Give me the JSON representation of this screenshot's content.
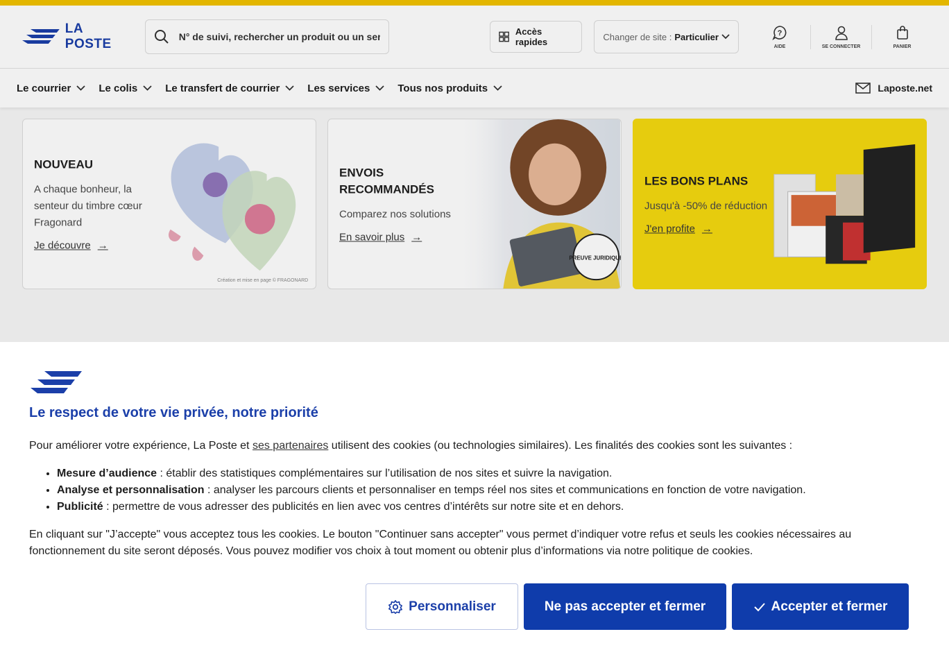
{
  "header": {
    "logo_text": "LA POSTE",
    "search_placeholder": "N° de suivi, rechercher un produit ou un servi...",
    "quick_access": "Accès rapides",
    "site_label": "Changer de site :",
    "site_value": "Particulier",
    "icons": {
      "help": "AIDE",
      "login": "SE CONNECTER",
      "cart": "PANIER"
    }
  },
  "nav": {
    "items": [
      "Le courrier",
      "Le colis",
      "Le transfert de courrier",
      "Les services",
      "Tous nos produits"
    ],
    "mail_link": "Laposte.net"
  },
  "cards": [
    {
      "title": "NOUVEAU",
      "desc": "A chaque bonheur, la senteur du timbre cœur Fragonard",
      "cta": "Je découvre",
      "caption": "Création et mise en page © FRAGONARD"
    },
    {
      "title": "ENVOIS RECOMMANDÉS",
      "desc": "Comparez nos solutions",
      "cta": "En savoir plus",
      "badge": "PREUVE JURIDIQUE"
    },
    {
      "title": "LES BONS PLANS",
      "desc": "Jusqu'à -50% de réduction",
      "cta": "J'en profite"
    }
  ],
  "consent": {
    "title": "Le respect de votre vie privée, notre priorité",
    "intro_before": "Pour améliorer votre expérience, La Poste et ",
    "intro_link": "ses partenaires",
    "intro_after": " utilisent des cookies (ou technologies similaires). Les finalités des cookies sont les suivantes :",
    "purposes": [
      {
        "name": "Mesure d’audience",
        "text": " : établir des statistiques complémentaires sur l’utilisation de nos sites et suivre la navigation."
      },
      {
        "name": "Analyse et personnalisation",
        "text": " : analyser les parcours clients et personnaliser en temps réel nos sites et communications en fonction de votre navigation."
      },
      {
        "name": "Publicité",
        "text": " : permettre de vous adresser des publicités en lien avec vos centres d’intérêts sur notre site et en dehors."
      }
    ],
    "footer": "En cliquant sur \"J’accepte\" vous acceptez tous les cookies. Le bouton \"Continuer sans accepter\" vous permet d’indiquer votre refus et seuls les cookies nécessaires au fonctionnement du site seront déposés. Vous pouvez modifier vos choix à tout moment ou obtenir plus d’informations via notre politique de cookies.",
    "btn_customize": "Personnaliser",
    "btn_decline": "Ne pas accepter et fermer",
    "btn_accept": "Accepter et fermer"
  },
  "colors": {
    "brand_blue": "#1b3fa9",
    "brand_yellow": "#f2c200",
    "button_blue": "#0f3cab"
  }
}
